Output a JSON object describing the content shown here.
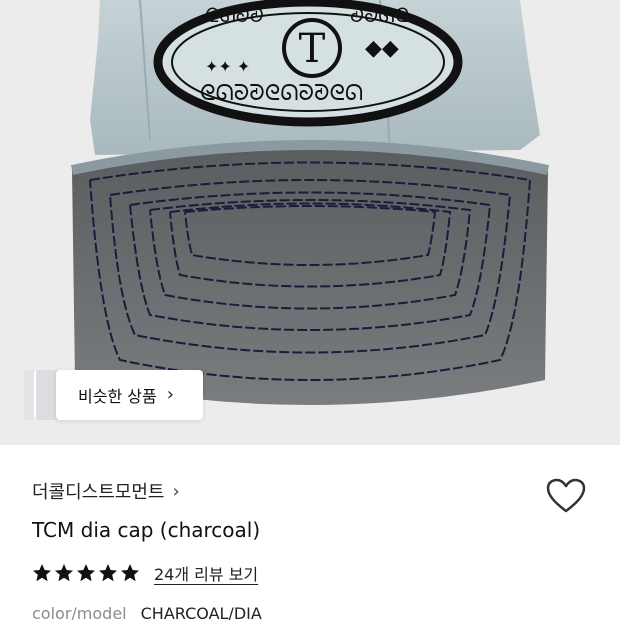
{
  "hero": {
    "image_desc_icon": "cap-product-image",
    "similar_button": {
      "label": "비슷한 상품",
      "chevron": "›"
    }
  },
  "product": {
    "brand": "더콜디스트모먼트",
    "brand_chevron": "›",
    "title": "TCM dia cap (charcoal)",
    "rating": 5,
    "review_link": "24개 리뷰 보기",
    "spec": {
      "label": "color/model",
      "value": "CHARCOAL/DIA"
    }
  },
  "icons": {
    "heart": "heart-outline-icon",
    "star": "star-icon"
  },
  "colors": {
    "crown": "#b8c7cc",
    "brim": "#6d7073",
    "stitch": "#1c1c3a",
    "background": "#ececec"
  }
}
